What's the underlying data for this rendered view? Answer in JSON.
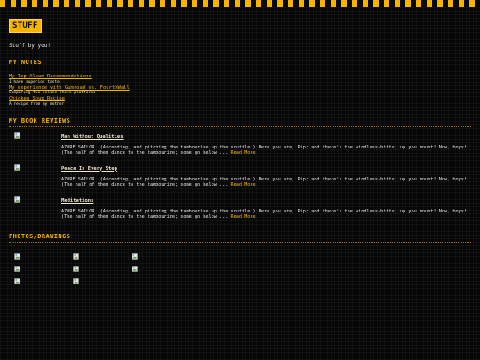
{
  "site": {
    "badge": "STUFF",
    "tagline": "Stuff by you!"
  },
  "notes": {
    "title": "MY NOTES",
    "items": [
      {
        "label": "My Top Album Recommendations",
        "desc": "I have superior taste"
      },
      {
        "label": "My experience with Gumroad vs. FourthWall",
        "desc": "Comparing two online store platforms"
      },
      {
        "label": "Chicken Soup Recipe",
        "desc": "A recipe from my mother"
      }
    ]
  },
  "reviews": {
    "title": "MY BOOK REVIEWS",
    "items": [
      {
        "title": "Man Without Qualities",
        "excerpt": "AZORE SAILOR. (Ascending, and pitching the tambourine up the scuttle.) Here you are, Pip; and there's the windlass-bitts; up you mount! Now, boys! (The half of them dance to the tambourine; some go below ...",
        "read_more": "Read More"
      },
      {
        "title": "Peace Is Every Step",
        "excerpt": "AZORE SAILOR. (Ascending, and pitching the tambourine up the scuttle.) Here you are, Pip; and there's the windlass-bitts; up you mount! Now, boys! (The half of them dance to the tambourine; some go below ...",
        "read_more": "Read More"
      },
      {
        "title": "Meditations",
        "excerpt": "AZORE SAILOR. (Ascending, and pitching the tambourine up the scuttle.) Here you are, Pip; and there's the windlass-bitts; up you mount! Now, boys! (The half of them dance to the tambourine; some go below ...",
        "read_more": "Read More"
      }
    ]
  },
  "photos": {
    "title": "PHOTOS/DRAWINGS",
    "count": 8,
    "icon": "broken-image-icon"
  },
  "colors": {
    "accent": "#f5b400",
    "background": "#070707",
    "text": "#e6e6e6"
  }
}
